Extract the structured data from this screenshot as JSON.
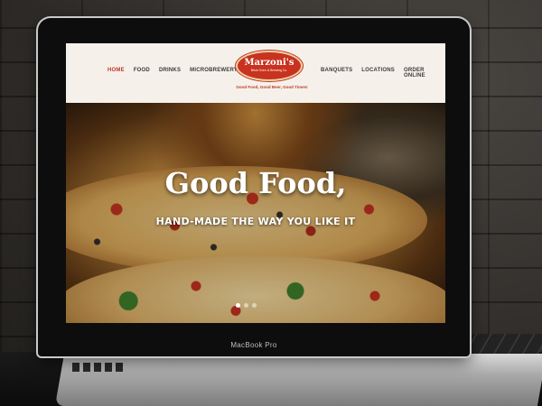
{
  "site": {
    "nav_left": [
      {
        "label": "HOME",
        "active": true
      },
      {
        "label": "FOOD",
        "active": false
      },
      {
        "label": "DRINKS",
        "active": false
      },
      {
        "label": "MICROBREWERY",
        "active": false
      }
    ],
    "nav_right": [
      {
        "label": "BANQUETS",
        "active": false
      },
      {
        "label": "LOCATIONS",
        "active": false
      },
      {
        "label": "ORDER ONLINE",
        "active": false
      }
    ],
    "logo": {
      "name": "Marzoni's",
      "sub": "Brick Oven & Brewing Co."
    },
    "tagline": "Good Food, Good Beer, Good Times!",
    "accent_color": "#c0392b"
  },
  "hero": {
    "title": "Good Food,",
    "subtitle": "HAND-MADE THE WAY YOU LIKE IT",
    "slides": 3,
    "active_slide": 0
  },
  "device": {
    "brand": "MacBook Pro"
  }
}
